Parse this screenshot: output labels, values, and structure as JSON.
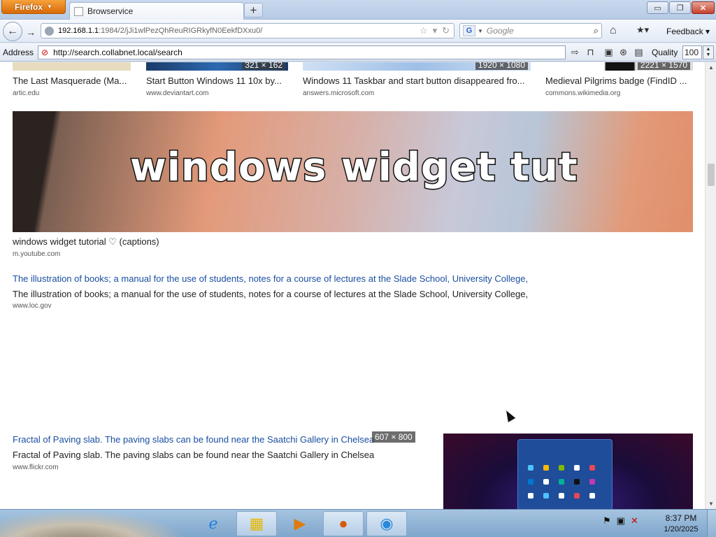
{
  "window": {
    "app_button": "Firefox",
    "tab_title": "Browservice",
    "new_tab": "+",
    "controls": {
      "minimize": "▭",
      "maximize": "❐",
      "close": "✕"
    }
  },
  "navbar": {
    "back": "←",
    "forward": "→",
    "url_host": "192.168.1.1",
    "url_path": ":1984/2/jJi1wlPezQhReuRIGRkyfN0EekfDXxu0/",
    "search_placeholder": "Google",
    "search_engine": "G",
    "feedback_label": "Feedback"
  },
  "addressbar": {
    "label": "Address",
    "value": "http://search.collabnet.local/search",
    "quality_label": "Quality",
    "quality_value": "100"
  },
  "top_results": [
    {
      "title": "The Last Masquerade (Ma...",
      "source": "artic.edu"
    },
    {
      "title": "Start Button Windows 11 10x by...",
      "source": "www.deviantart.com",
      "badge": "321 × 162"
    },
    {
      "title": "Windows 11 Taskbar and start button disappeared fro...",
      "source": "answers.microsoft.com",
      "badge": "1920 × 1080"
    },
    {
      "title": "Medieval Pilgrims badge (FindID ...",
      "source": "commons.wikimedia.org",
      "badge": "2221 × 1570"
    }
  ],
  "banner_result": {
    "image_text": "windows widget tut",
    "title": "windows widget tutorial ♡ (captions)",
    "source": "m.youtube.com"
  },
  "books_result": {
    "alt_link": "The illustration of books; a manual for the use of students, notes for a course of lectures at the Slade School, University College,",
    "title": "The illustration of books; a manual for the use of students, notes for a course of lectures at the Slade School, University College,",
    "source": "www.loc.gov"
  },
  "fractal_result": {
    "alt_link": "Fractal of Paving slab. The paving slabs can be found near the Saatchi Gallery in Chelsea",
    "badge": "607 × 800",
    "title": "Fractal of Paving slab. The paving slabs can be found near the Saatchi Gallery in Chelsea",
    "source": "www.flickr.com"
  },
  "taskbar": {
    "apps": [
      "internet-explorer",
      "windows-explorer",
      "media-player",
      "firefox",
      "app"
    ],
    "time": "8:37 PM",
    "date": "1/20/2025"
  },
  "colors": {
    "link": "#1a4fa0",
    "firefox_orange": "#d86a06",
    "chrome_blue": "#c9d9ee"
  }
}
